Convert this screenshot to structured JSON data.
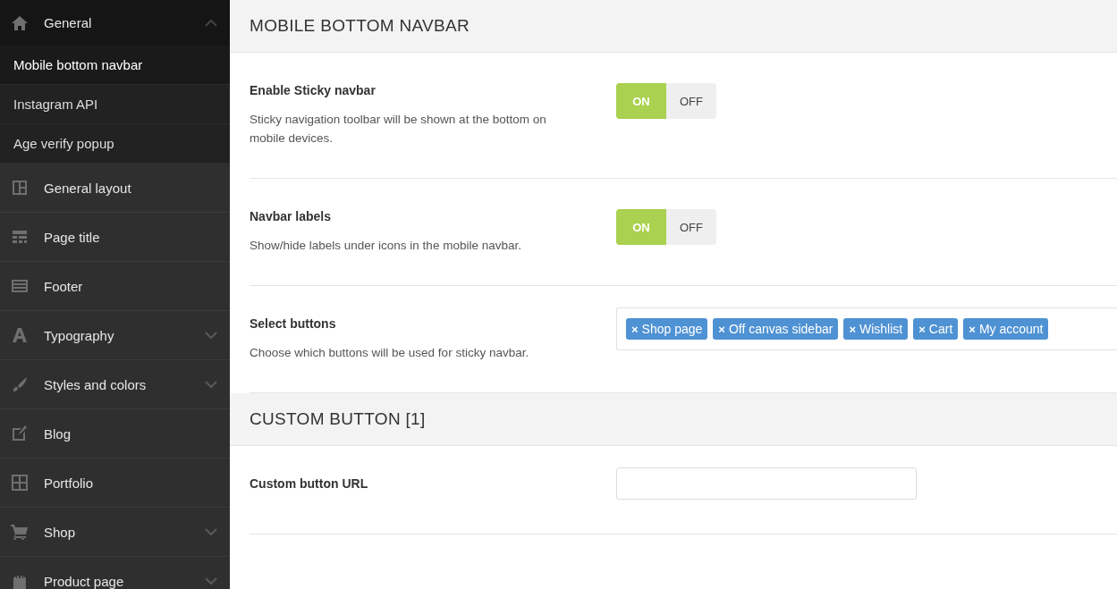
{
  "sidebar": {
    "items": [
      {
        "label": "General",
        "kind": "group",
        "expanded": true,
        "children": [
          {
            "label": "Mobile bottom navbar",
            "selected": true
          },
          {
            "label": "Instagram API",
            "selected": false
          },
          {
            "label": "Age verify popup",
            "selected": false
          }
        ]
      },
      {
        "label": "General layout",
        "kind": "link"
      },
      {
        "label": "Page title",
        "kind": "link"
      },
      {
        "label": "Footer",
        "kind": "link"
      },
      {
        "label": "Typography",
        "kind": "group",
        "expanded": false
      },
      {
        "label": "Styles and colors",
        "kind": "group",
        "expanded": false
      },
      {
        "label": "Blog",
        "kind": "link"
      },
      {
        "label": "Portfolio",
        "kind": "link"
      },
      {
        "label": "Shop",
        "kind": "group",
        "expanded": false
      },
      {
        "label": "Product page",
        "kind": "group",
        "expanded": false
      }
    ]
  },
  "sections": [
    {
      "title": "MOBILE BOTTOM NAVBAR",
      "fields": [
        {
          "kind": "toggle",
          "label": "Enable Sticky navbar",
          "description": "Sticky navigation toolbar will be shown at the bottom on mobile devices.",
          "on": true,
          "on_label": "ON",
          "off_label": "OFF"
        },
        {
          "kind": "toggle",
          "label": "Navbar labels",
          "description": "Show/hide labels under icons in the mobile navbar.",
          "on": true,
          "on_label": "ON",
          "off_label": "OFF"
        },
        {
          "kind": "tags",
          "label": "Select buttons",
          "description": "Choose which buttons will be used for sticky navbar.",
          "tags": [
            {
              "remove": "×",
              "label": "Shop page"
            },
            {
              "remove": "×",
              "label": "Off canvas sidebar"
            },
            {
              "remove": "×",
              "label": "Wishlist"
            },
            {
              "remove": "×",
              "label": "Cart"
            },
            {
              "remove": "×",
              "label": "My account"
            }
          ]
        }
      ]
    },
    {
      "title": "CUSTOM BUTTON [1]",
      "fields": [
        {
          "kind": "text",
          "label": "Custom button URL"
        }
      ]
    }
  ]
}
